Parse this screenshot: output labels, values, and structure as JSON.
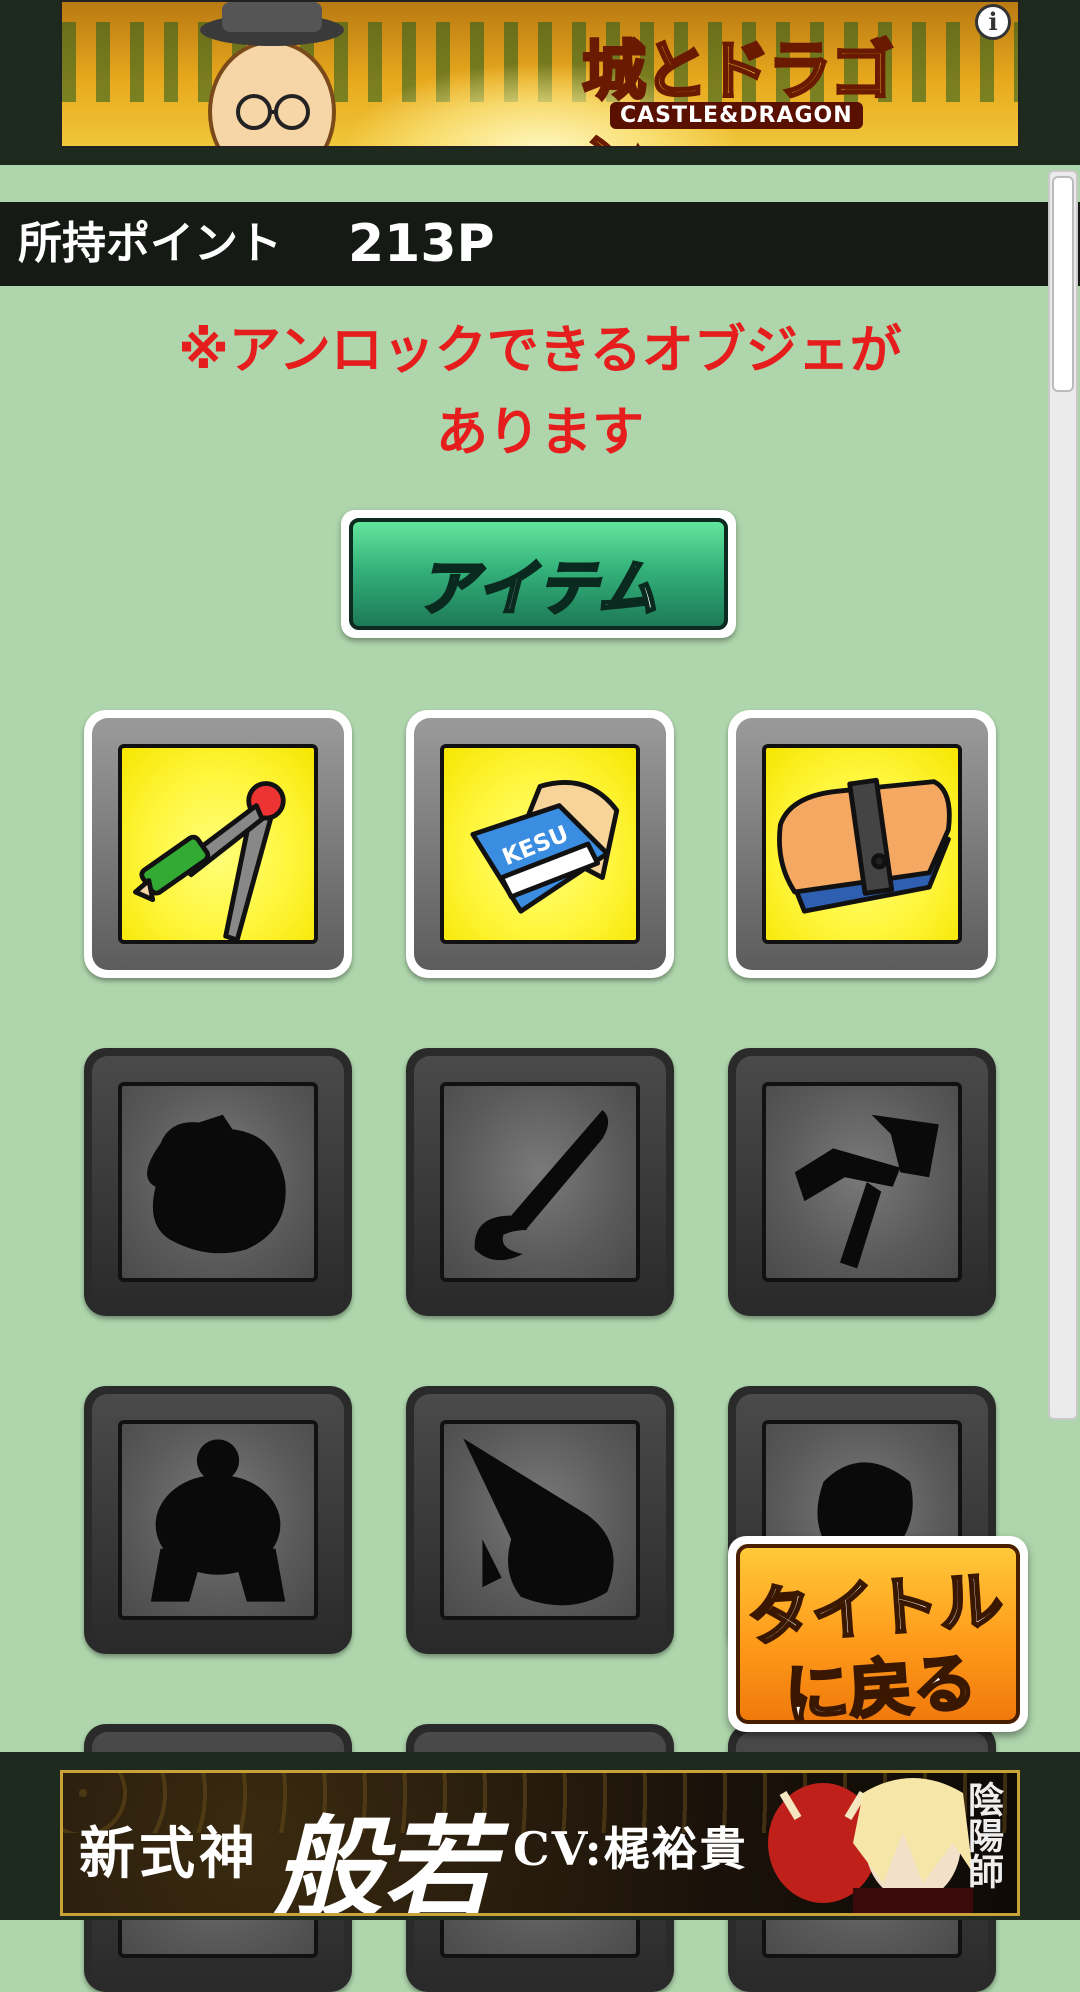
{
  "top_ad": {
    "logo_text": "城とドラゴン",
    "logo_sub": "CASTLE&DRAGON",
    "info_icon": "i"
  },
  "points": {
    "label": "所持ポイント",
    "value": "213P"
  },
  "notice": {
    "line1": "※アンロックできるオブジェが",
    "line2": "あります"
  },
  "item_button": {
    "label": "アイテム"
  },
  "objects": [
    {
      "name": "compass",
      "state": "unlocked"
    },
    {
      "name": "eraser-kesu",
      "state": "unlocked"
    },
    {
      "name": "pencil-case",
      "state": "unlocked"
    },
    {
      "name": "pot",
      "state": "locked"
    },
    {
      "name": "brush",
      "state": "locked"
    },
    {
      "name": "spring-gadget",
      "state": "locked"
    },
    {
      "name": "sumo-figure",
      "state": "locked"
    },
    {
      "name": "bird-sword",
      "state": "locked"
    },
    {
      "name": "head-bust",
      "state": "locked"
    }
  ],
  "title_button": {
    "line1": "タイトル",
    "line2": "に戻る"
  },
  "bottom_ad": {
    "prefix": "新式神",
    "name": "般若",
    "cv": "CV:梶裕貴",
    "brand": "陰陽師"
  },
  "colors": {
    "background": "#aed5ac",
    "notice_red": "#e61d1d",
    "unlocked_tile": "#fff53a",
    "locked_tile": "#5a5a5a",
    "item_button": "#34b37b",
    "title_button": "#ff9a1a"
  }
}
